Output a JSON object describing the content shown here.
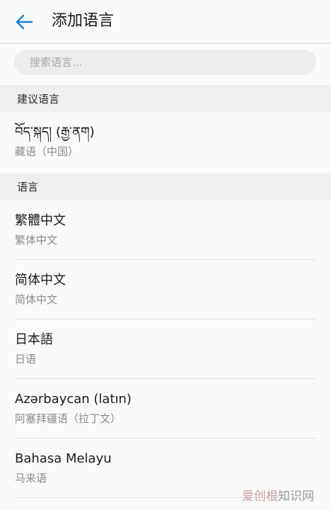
{
  "header": {
    "back_icon": "arrow-left-icon",
    "title": "添加语言",
    "accent_color": "#1a7fd0"
  },
  "search": {
    "placeholder": "搜索语言..."
  },
  "suggested": {
    "label": "建议语言",
    "items": [
      {
        "primary": "བོད་སྐད། (རྒྱ་ནག)",
        "secondary": "藏语（中国）"
      }
    ]
  },
  "languages": {
    "label": "语言",
    "items": [
      {
        "primary": "繁體中文",
        "secondary": "繁体中文"
      },
      {
        "primary": "简体中文",
        "secondary": "简体中文"
      },
      {
        "primary": "日本語",
        "secondary": "日语"
      },
      {
        "primary": "Azərbaycan (latın)",
        "secondary": "阿塞拜疆语（拉丁文）"
      },
      {
        "primary": "Bahasa Melayu",
        "secondary": "马来语"
      }
    ]
  },
  "watermark": {
    "accent_text": "爱创根",
    "text": "知识网"
  }
}
